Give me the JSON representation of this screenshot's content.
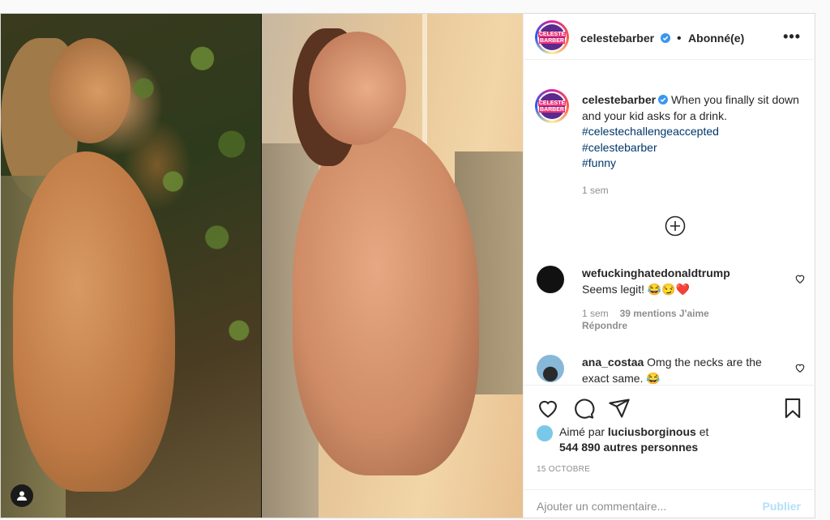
{
  "post": {
    "author": "celestebarber",
    "follow_state": "Abonné(e)",
    "dot": "•",
    "more": "•••",
    "avatar_text_top": "CELESTE",
    "avatar_text_bottom": "BARBER"
  },
  "caption": {
    "author": "celestebarber",
    "text": "When you finally sit down and your kid asks for a drink.",
    "hashtags": [
      "#celestechallengeaccepted",
      "#celestebarber",
      "#funny"
    ],
    "time": "1 sem"
  },
  "comments": [
    {
      "author": "wefuckinghatedonaldtrump",
      "text": "Seems legit! 😂😏❤️",
      "time": "1 sem",
      "likes": "39 mentions J'aime",
      "reply": "Répondre"
    },
    {
      "author": "ana_costaa",
      "text": "Omg the necks are the exact same. 😂"
    }
  ],
  "likes": {
    "prefix": "Aimé par",
    "user": "luciusborginous",
    "suffix": "et",
    "count": "544 890 autres personnes"
  },
  "date": "15 OCTOBRE",
  "add_comment": {
    "placeholder": "Ajouter un commentaire...",
    "publish": "Publier"
  },
  "colors": {
    "link": "#00376b",
    "verified": "#3897f0",
    "publish_disabled": "#b2dffc"
  }
}
